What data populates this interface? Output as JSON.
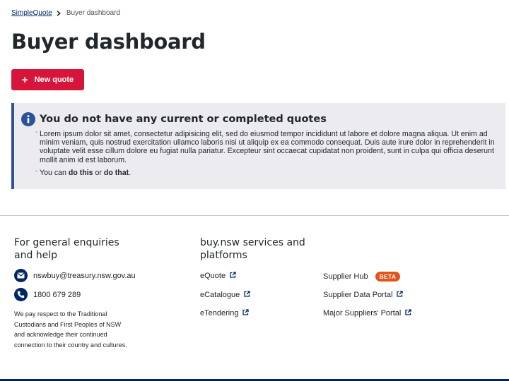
{
  "breadcrumb": {
    "home": "SimpleQuote",
    "current": "Buyer dashboard"
  },
  "page": {
    "title": "Buyer dashboard"
  },
  "actions": {
    "new_quote": "New quote"
  },
  "notice": {
    "title": "You do not have any current or completed quotes",
    "paragraph": "Lorem ipsum dolor sit amet, consectetur adipisicing elit, sed do eiusmod tempor incididunt ut labore et dolore magna aliqua. Ut enim ad minim veniam, quis nostrud exercitation ullamco laboris nisi ut aliquip ex ea commodo consequat. Duis aute irure dolor in reprehenderit in voluptate velit esse cillum dolore eu fugiat nulla pariatur. Excepteur sint occaecat cupidatat non proident, sunt in culpa qui officia deserunt mollit anim id est laborum.",
    "line2_prefix": "You can ",
    "link1": "do this",
    "line2_mid": " or ",
    "link2": "do that",
    "line2_suffix": "."
  },
  "footer": {
    "enquiries_title_1": "For general enquiries",
    "enquiries_title_2": "and help",
    "email": "nswbuy@treasury.nsw.gov.au",
    "phone": "1800 679 289",
    "acknowledgement": "We pay respect to the Traditional Custodians and First Peoples of NSW and acknowledge their continued connection to their country and cultures.",
    "services_title_1": "buy.nsw services and",
    "services_title_2": "platforms",
    "links": {
      "equote": "eQuote",
      "ecatalogue": "eCatalogue",
      "etendering": "eTendering",
      "supplier_hub": "Supplier Hub",
      "supplier_hub_badge": "BETA",
      "supplier_data_portal": "Supplier Data Portal",
      "major_suppliers_portal": "Major Suppliers' Portal"
    }
  },
  "colors": {
    "primary": "#002664",
    "accent": "#d7153a",
    "info_border": "#2e5299",
    "notice_bg": "#ebebf0",
    "beta": "#e3541d"
  }
}
